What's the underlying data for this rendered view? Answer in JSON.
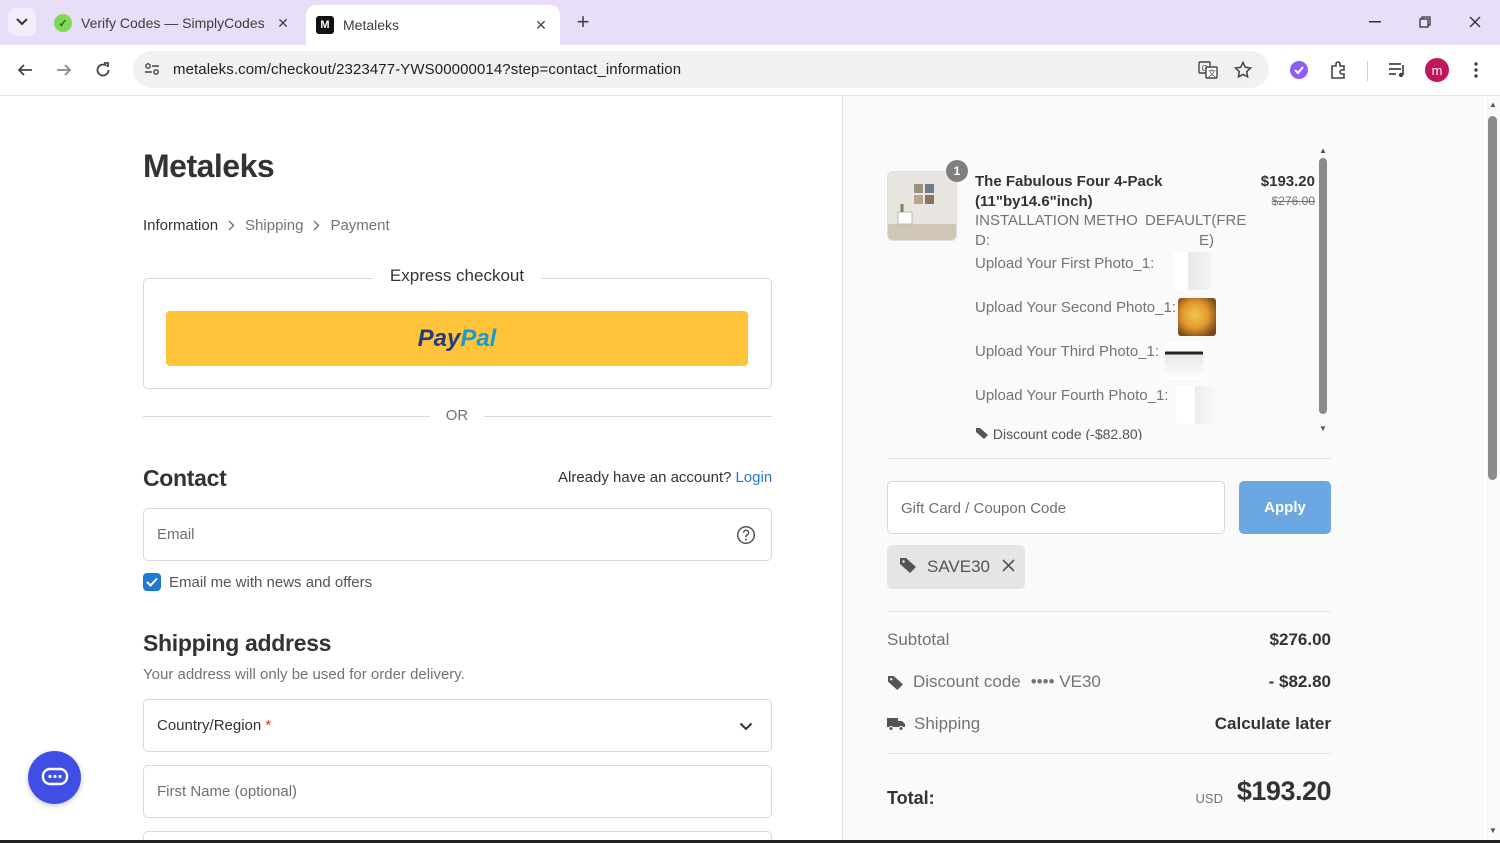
{
  "browser": {
    "tabs": [
      {
        "title": "Verify Codes — SimplyCodes",
        "active": false
      },
      {
        "title": "Metaleks",
        "active": true
      }
    ],
    "url": "metaleks.com/checkout/2323477-YWS00000014?step=contact_information",
    "profile_initial": "m"
  },
  "store": {
    "name": "Metaleks"
  },
  "breadcrumb": [
    "Information",
    "Shipping",
    "Payment"
  ],
  "express": {
    "title": "Express checkout",
    "paypal_label_1": "Pay",
    "paypal_label_2": "Pal",
    "or_text": "OR"
  },
  "contact": {
    "heading": "Contact",
    "account_prompt": "Already have an account?",
    "login_link": "Login",
    "email_placeholder": "Email",
    "news_checkbox_label": "Email me with news and offers",
    "news_checked": true
  },
  "shipping": {
    "heading": "Shipping address",
    "note": "Your address will only be used for order delivery.",
    "country_placeholder": "Country/Region",
    "required_mark": "*",
    "first_name_placeholder": "First Name (optional)"
  },
  "order": {
    "item": {
      "quantity": "1",
      "name": "The Fabulous Four 4-Pack (11\"by14.6\"inch)",
      "price": "$193.20",
      "original_price": "$276.00",
      "option_label_a": "INSTALLATION METHO",
      "option_label_b": "D:",
      "option_value_a": "DEFAULT(FRE",
      "option_value_b": "E)",
      "uploads": [
        "Upload Your First Photo_1:",
        "Upload Your Second Photo_1:",
        "Upload Your Third Photo_1:",
        "Upload Your Fourth Photo_1:"
      ],
      "discount_line": "Discount code (-$82.80)"
    },
    "coupon_placeholder": "Gift Card / Coupon Code",
    "apply_label": "Apply",
    "applied_code": "SAVE30",
    "subtotal_label": "Subtotal",
    "subtotal_value": "$276.00",
    "discount_label": "Discount code",
    "discount_code_masked": "•••• VE30",
    "discount_value": "- $82.80",
    "shipping_label": "Shipping",
    "shipping_value": "Calculate later",
    "total_label": "Total:",
    "currency": "USD",
    "total_value": "$193.20"
  },
  "colors": {
    "accent": "#1f7ad6",
    "paypal_yellow": "#ffc439",
    "apply_button": "#6aa7e3",
    "chat_button": "#3f4fe6"
  }
}
